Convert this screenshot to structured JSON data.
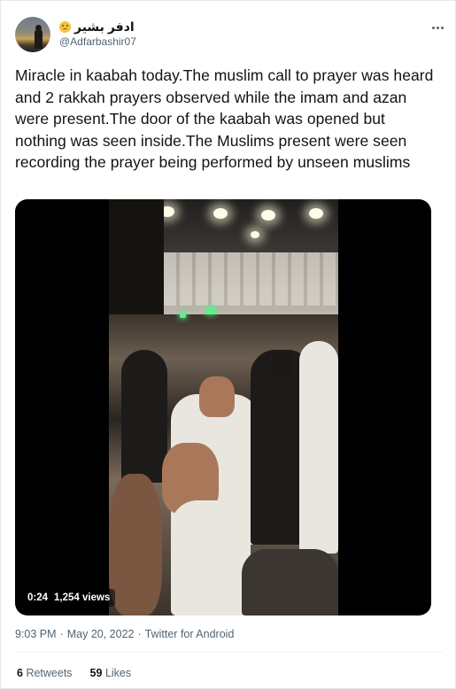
{
  "user": {
    "display_name": "ادفر بشير",
    "emoji_icon": "slightly-frowning-face-icon",
    "handle": "@Adfarbashir07"
  },
  "tweet": {
    "text": "Miracle in kaabah today.The muslim call to prayer was heard and 2 rakkah prayers observed while the imam and azan were present.The door of the kaabah was opened but nothing was seen inside.The Muslims present were seen recording the prayer being performed by unseen muslims"
  },
  "video": {
    "duration": "0:24",
    "views": "1,254 views"
  },
  "meta": {
    "time": "9:03 PM",
    "separator": "·",
    "date": "May 20, 2022",
    "separator2": "·",
    "source": "Twitter for Android"
  },
  "stats": {
    "retweets_count": "6",
    "retweets_label": "Retweets",
    "likes_count": "59",
    "likes_label": "Likes"
  },
  "colors": {
    "text_primary": "#0f1419",
    "text_secondary": "#536471",
    "divider": "#eff3f4"
  }
}
